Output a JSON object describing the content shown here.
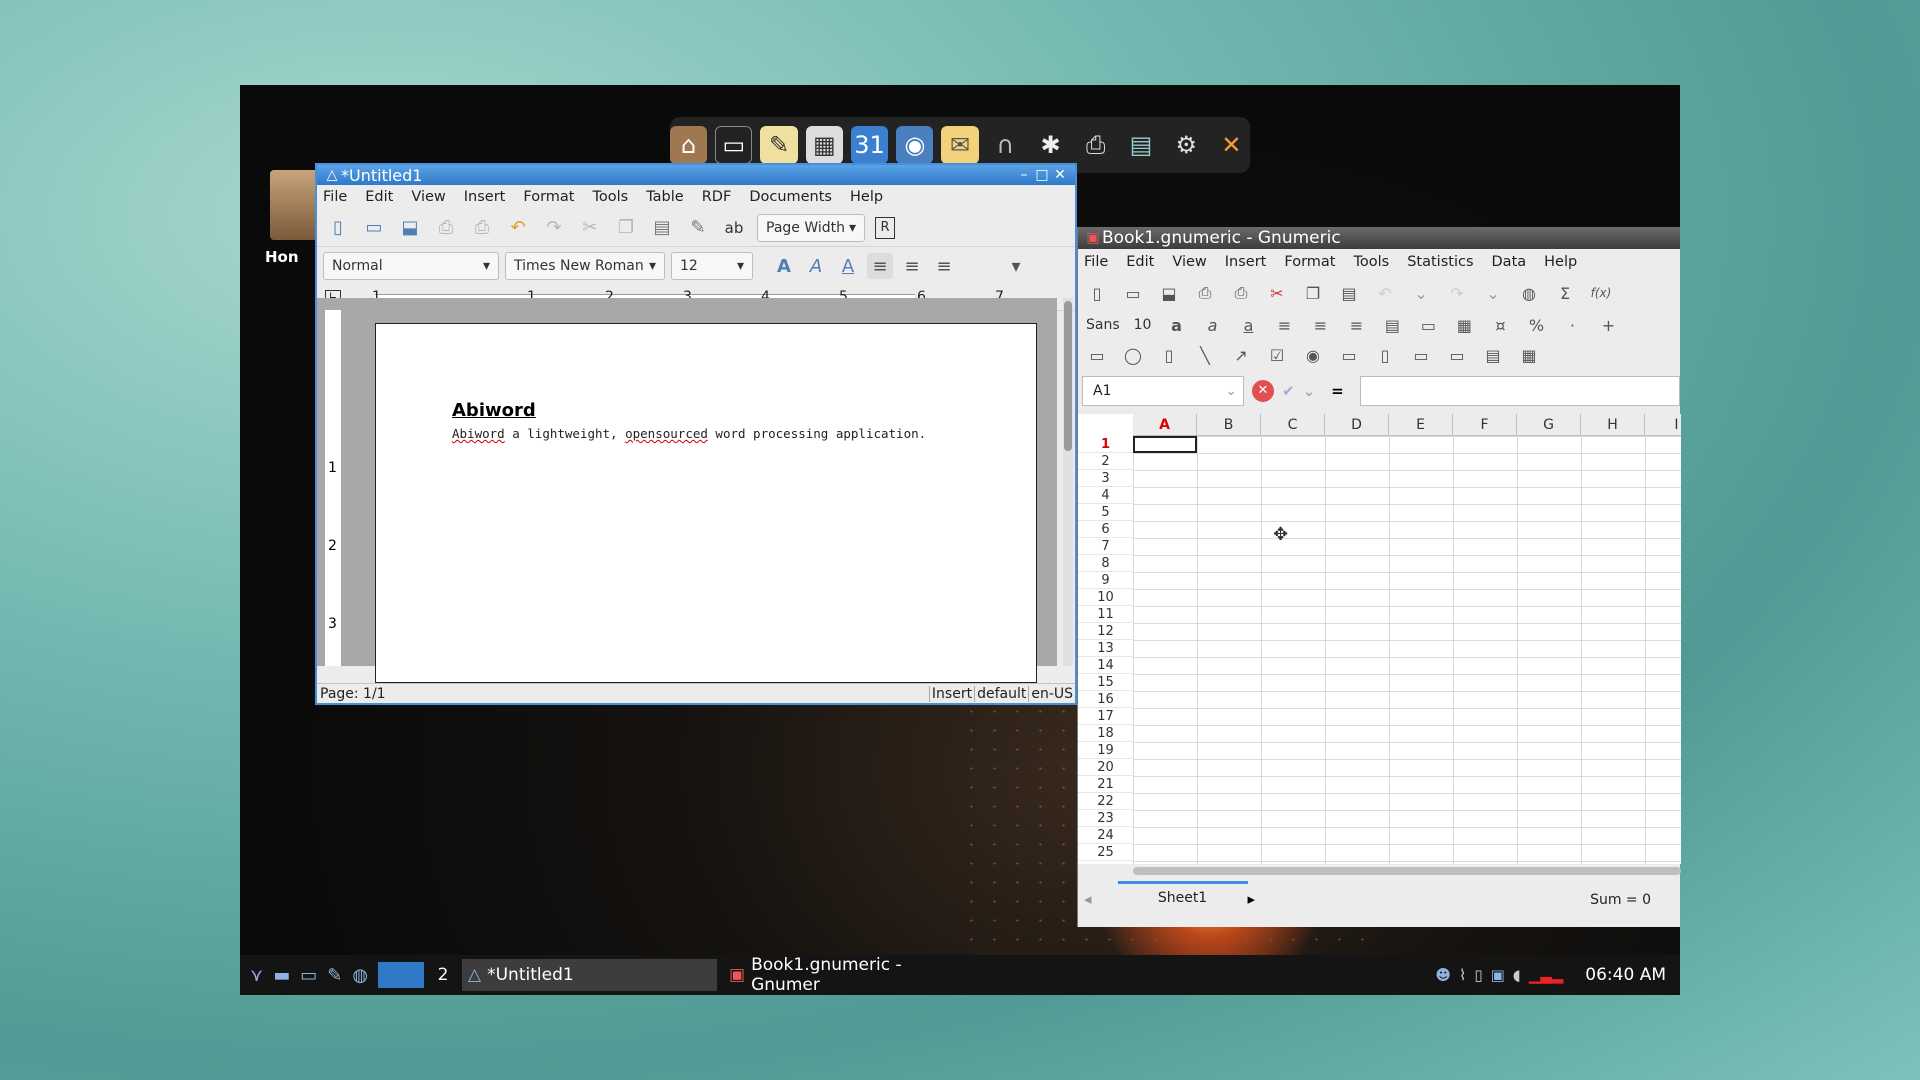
{
  "dock": {
    "icons": [
      "home-icon",
      "terminal-icon",
      "text-editor-icon",
      "spreadsheet-icon",
      "calendar-icon",
      "globe-icon",
      "mail-icon",
      "headphones-icon",
      "film-reel-icon",
      "printer-icon",
      "files-icon",
      "settings-icon",
      "tools-icon"
    ]
  },
  "desktop": {
    "home_label": "Hon"
  },
  "abiword": {
    "title": "*Untitled1",
    "menu": [
      "File",
      "Edit",
      "View",
      "Insert",
      "Format",
      "Tools",
      "Table",
      "RDF",
      "Documents",
      "Help"
    ],
    "zoom": "Page Width",
    "style": "Normal",
    "font": "Times New Roman",
    "size": "12",
    "ruler": [
      "1",
      "1",
      "2",
      "3",
      "4",
      "5",
      "6",
      "7"
    ],
    "vruler": [
      "1",
      "2",
      "3"
    ],
    "doc_title": "Abiword",
    "doc_body": {
      "word1": "Abiword",
      "part2": " a lightweight, ",
      "word2": "opensourced",
      "part3": " word processing application."
    },
    "status": {
      "page": "Page: 1/1",
      "mode": "Insert",
      "style": "default",
      "lang": "en-US"
    }
  },
  "gnumeric": {
    "title": "Book1.gnumeric - Gnumeric",
    "menu": [
      "File",
      "Edit",
      "View",
      "Insert",
      "Format",
      "Tools",
      "Statistics",
      "Data",
      "Help"
    ],
    "font": "Sans",
    "size": "10",
    "cell_ref": "A1",
    "equals": "=",
    "columns": [
      "A",
      "B",
      "C",
      "D",
      "E",
      "F",
      "G",
      "H",
      "I"
    ],
    "rows": [
      "1",
      "2",
      "3",
      "4",
      "5",
      "6",
      "7",
      "8",
      "9",
      "10",
      "11",
      "12",
      "13",
      "14",
      "15",
      "16",
      "17",
      "18",
      "19",
      "20",
      "21",
      "22",
      "23",
      "24",
      "25"
    ],
    "sheet_tab": "Sheet1",
    "sum": "Sum = 0"
  },
  "taskbar": {
    "workspace": "2",
    "tasks": [
      "*Untitled1",
      "Book1.gnumeric - Gnumer"
    ],
    "clock": "06:40 AM"
  }
}
